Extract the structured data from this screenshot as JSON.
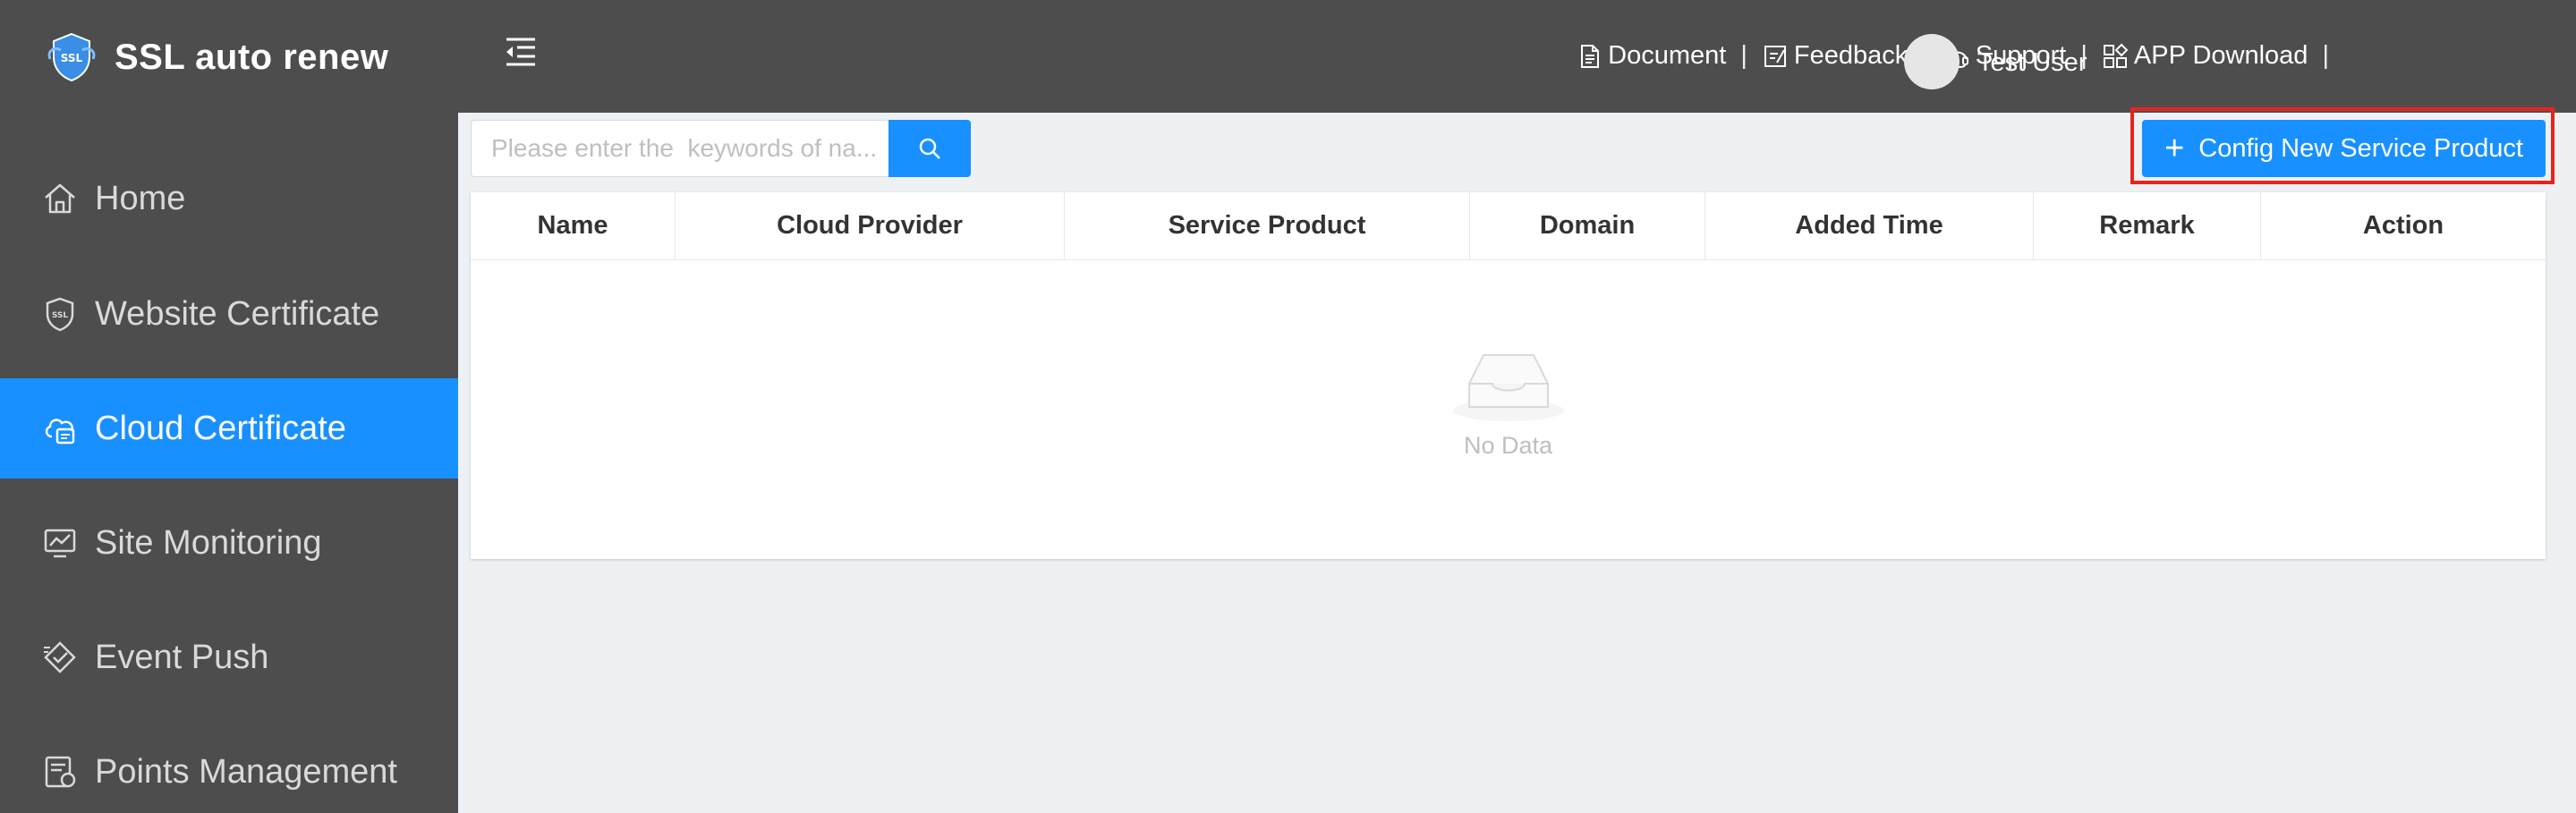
{
  "app": {
    "title": "SSL auto renew"
  },
  "sidebar": {
    "items": [
      {
        "label": "Home",
        "icon": "home-icon",
        "active": false
      },
      {
        "label": "Website Certificate",
        "icon": "ssl-shield-icon",
        "active": false
      },
      {
        "label": "Cloud Certificate",
        "icon": "cloud-certificate-icon",
        "active": true
      },
      {
        "label": "Site Monitoring",
        "icon": "monitor-chart-icon",
        "active": false
      },
      {
        "label": "Event Push",
        "icon": "event-push-icon",
        "active": false
      },
      {
        "label": "Points Management",
        "icon": "points-icon",
        "active": false
      }
    ]
  },
  "header": {
    "links": [
      {
        "label": "Document",
        "icon": "document-icon"
      },
      {
        "label": "Feedback",
        "icon": "feedback-icon"
      },
      {
        "label": "Support",
        "icon": "headset-icon"
      },
      {
        "label": "APP Download",
        "icon": "apps-icon"
      }
    ],
    "separator": "|",
    "user": {
      "name": "Test User"
    }
  },
  "toolbar": {
    "search_placeholder": "Please enter the  keywords of na...",
    "config_button_label": "Config New Service Product"
  },
  "table": {
    "columns": [
      "Name",
      "Cloud Provider",
      "Service Product",
      "Domain",
      "Added Time",
      "Remark",
      "Action"
    ],
    "rows": [],
    "empty_text": "No Data"
  },
  "colors": {
    "sidebar_bg": "#4d4d4d",
    "accent": "#1890ff",
    "highlight": "#e8231e",
    "page_bg": "#eef1f4"
  }
}
